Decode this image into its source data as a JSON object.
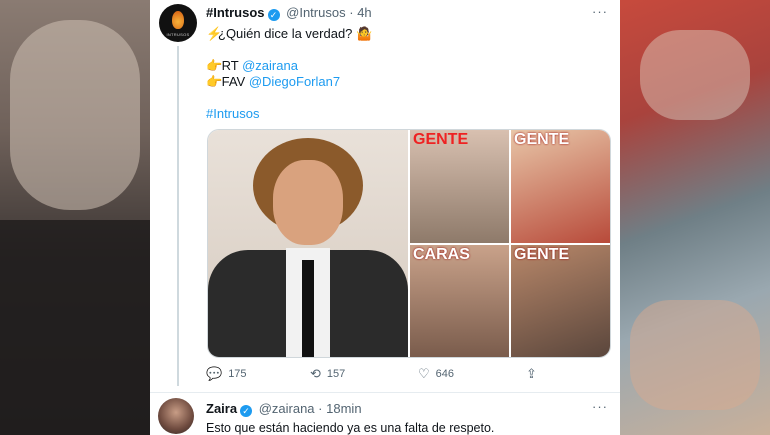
{
  "tweet": {
    "avatar_text": "INTRUSOS",
    "name": "#Intrusos",
    "verified_glyph": "✓",
    "handle": "@Intrusos",
    "separator": "·",
    "time": "4h",
    "more": "···",
    "line1_icon": "⚡",
    "line1_text": "¿Quién dice la verdad? ",
    "line1_emoji": "🤷",
    "rt_icon": "👉",
    "rt_label": "RT ",
    "rt_mention": "@zairana",
    "fav_icon": "👉",
    "fav_label": "FAV ",
    "fav_mention": "@DiegoForlan7",
    "hashtag": "#Intrusos",
    "covers": [
      {
        "mast": "GENTE"
      },
      {
        "mast": "GENTE"
      },
      {
        "mast": "CARAS"
      },
      {
        "mast": "GENTE"
      }
    ],
    "reply_icon": "💬",
    "reply_count": "175",
    "retweet_icon": "⟲",
    "retweet_count": "157",
    "like_icon": "♡",
    "like_count": "646",
    "share_icon": "⇪"
  },
  "reply": {
    "name": "Zaira",
    "verified_glyph": "✓",
    "handle": "@zairana",
    "separator": "·",
    "time": "18min",
    "more": "···",
    "text": "Esto que están haciendo ya es una falta de respeto."
  },
  "colors": {
    "link": "#1d9bf0",
    "verified": "#1d9bf0",
    "text": "#0f1419",
    "muted": "#536471"
  }
}
